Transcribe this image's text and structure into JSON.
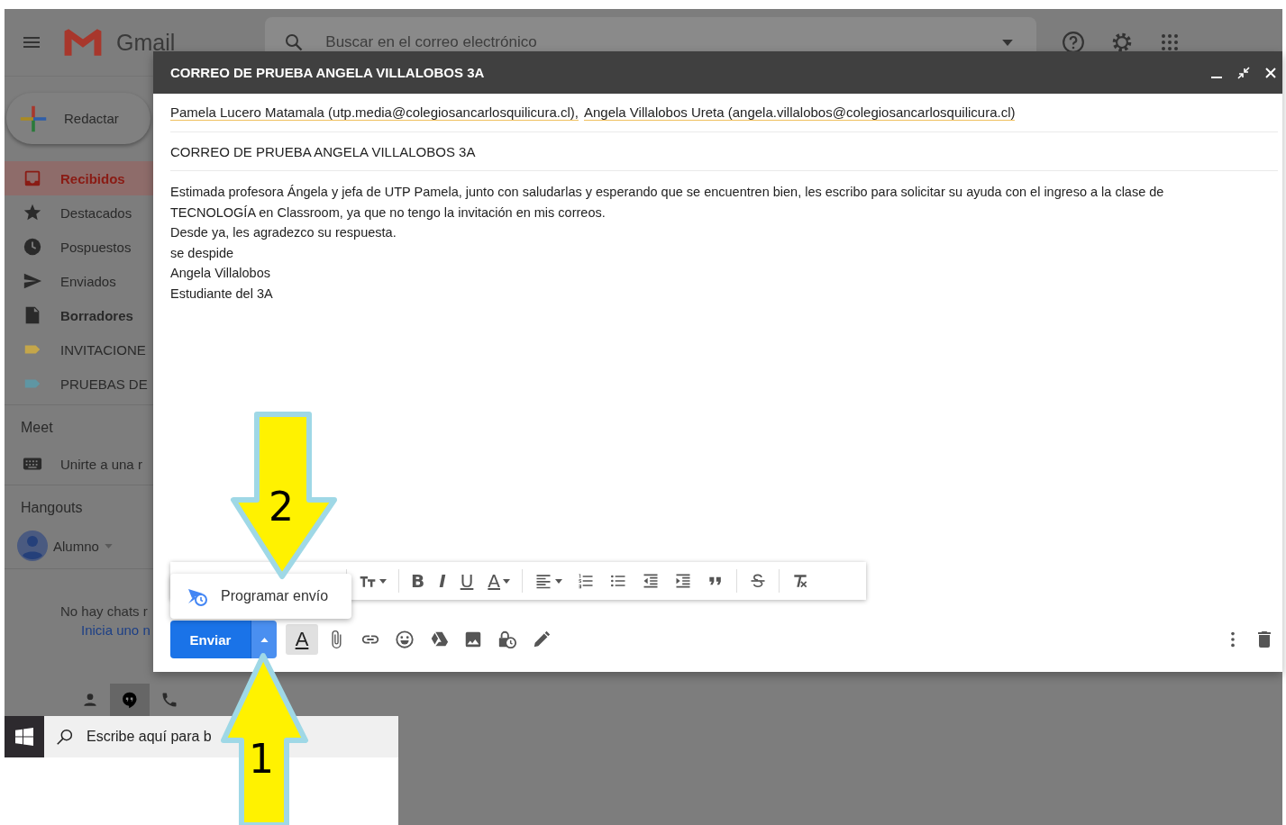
{
  "app": {
    "name": "Gmail"
  },
  "search": {
    "placeholder": "Buscar en el correo electrónico"
  },
  "compose_button": {
    "label": "Redactar"
  },
  "sidebar": {
    "items": [
      {
        "label": "Recibidos",
        "kind": "inbox",
        "selected": true,
        "bold": true
      },
      {
        "label": "Destacados",
        "kind": "star",
        "selected": false,
        "bold": false
      },
      {
        "label": "Pospuestos",
        "kind": "clock",
        "selected": false,
        "bold": false
      },
      {
        "label": "Enviados",
        "kind": "send",
        "selected": false,
        "bold": false
      },
      {
        "label": "Borradores",
        "kind": "draft",
        "selected": false,
        "bold": true
      },
      {
        "label": "INVITACIONE",
        "kind": "label",
        "color": "#c4a64a",
        "selected": false,
        "bold": false
      },
      {
        "label": "PRUEBAS DE",
        "kind": "label",
        "color": "#5f96a3",
        "selected": false,
        "bold": false
      }
    ]
  },
  "meet": {
    "title": "Meet",
    "item": "Unirte a una r"
  },
  "hangouts": {
    "title": "Hangouts",
    "user": "Alumno",
    "empty_text": "No hay chats r",
    "link": "Inicia uno n"
  },
  "chat_tabs": [
    {
      "kind": "person",
      "selected": false
    },
    {
      "kind": "hangouts",
      "selected": true
    },
    {
      "kind": "phone",
      "selected": false
    }
  ],
  "taskbar": {
    "search_placeholder": "Escribe aquí para b"
  },
  "compose": {
    "title": "CORREO DE PRUEBA ANGELA VILLALOBOS 3A",
    "recipients": [
      "Pamela Lucero Matamala (utp.media@colegiosancarlosquilicura.cl),",
      "Angela Villalobos Ureta (angela.villalobos@colegiosancarlosquilicura.cl)"
    ],
    "subject": "CORREO DE PRUEBA ANGELA VILLALOBOS 3A",
    "body": [
      "Estimada profesora Ángela y jefa de UTP Pamela, junto con saludarlas y esperando que se encuentren bien, les escribo para solicitar su ayuda con el ingreso a la clase de TECNOLOGÍA en Classroom, ya que no tengo la invitación en mis correos.",
      "Desde ya, les agradezco su respuesta.",
      "se despide",
      "Angela Villalobos",
      "Estudiante del 3A"
    ],
    "formatting_toolbar": {
      "groups": [
        [
          {
            "kind": "size"
          }
        ],
        [
          {
            "kind": "bold",
            "glyph": "B"
          },
          {
            "kind": "italic",
            "glyph": "I"
          },
          {
            "kind": "underline",
            "glyph": "U"
          },
          {
            "kind": "color",
            "glyph": "A"
          }
        ],
        [
          {
            "kind": "align"
          },
          {
            "kind": "numbered"
          },
          {
            "kind": "bulleted"
          },
          {
            "kind": "outdent"
          },
          {
            "kind": "indent"
          },
          {
            "kind": "quote"
          }
        ],
        [
          {
            "kind": "strike"
          }
        ],
        [
          {
            "kind": "clear"
          }
        ]
      ]
    },
    "send_button": {
      "label": "Enviar"
    },
    "send_menu": {
      "items": [
        {
          "label": "Programar envío"
        }
      ]
    },
    "actions": [
      {
        "kind": "text_format",
        "glyph": "A",
        "selected": true
      },
      {
        "kind": "attach"
      },
      {
        "kind": "link"
      },
      {
        "kind": "emoji"
      },
      {
        "kind": "drive"
      },
      {
        "kind": "photo"
      },
      {
        "kind": "confidential"
      },
      {
        "kind": "signature"
      }
    ]
  },
  "annotations": [
    {
      "label": "2",
      "kind": "down"
    },
    {
      "label": "1",
      "kind": "up"
    }
  ]
}
